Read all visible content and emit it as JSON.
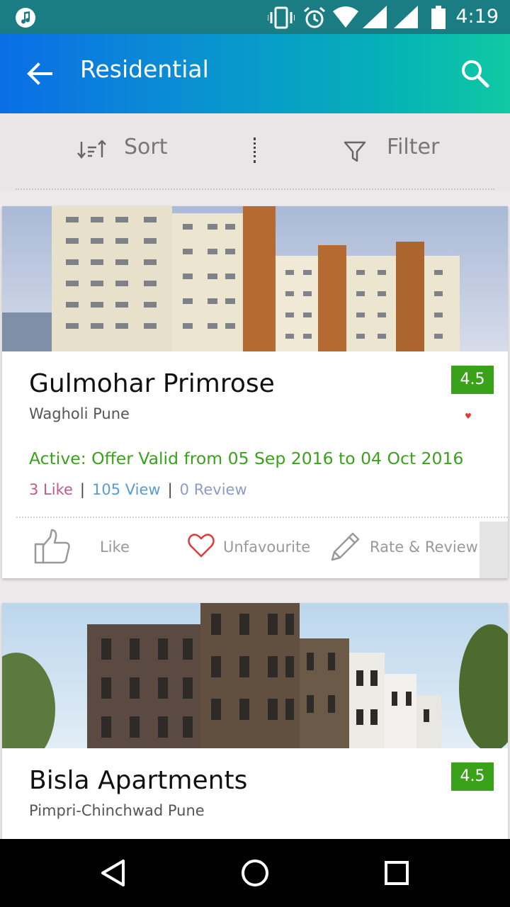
{
  "status_bar": {
    "time": "4:19",
    "icons": [
      "music-notification-icon",
      "vibrate-icon",
      "alarm-icon",
      "wifi-icon",
      "signal-icon",
      "signal-icon",
      "battery-icon"
    ]
  },
  "app_bar": {
    "title": "Residential",
    "back_icon": "arrow-left-icon",
    "search_icon": "search-icon",
    "color_start": "#0a6ee6",
    "color_end": "#0fc9a3"
  },
  "toolbar": {
    "sort_label": "Sort",
    "filter_label": "Filter"
  },
  "listings": [
    {
      "name": "Gulmohar Primrose",
      "location": "Wagholi Pune",
      "rating": "4.5",
      "offer": "Active: Offer Valid from 05 Sep 2016 to 04 Oct 2016",
      "likes": "3 Like",
      "views": "105 View",
      "reviews": "0 Review",
      "actions": {
        "like": "Like",
        "favourite": "Unfavourite",
        "review": "Rate & Review"
      }
    },
    {
      "name": "Bisla Apartments",
      "location": "Pimpri-Chinchwad Pune",
      "rating": "4.5"
    }
  ],
  "colors": {
    "accent_green": "#3aa21a",
    "like_pink": "#c05a8a",
    "view_blue": "#5a9bd6",
    "review_blue": "#8f9bc7",
    "heart_red": "#e23a3a"
  }
}
